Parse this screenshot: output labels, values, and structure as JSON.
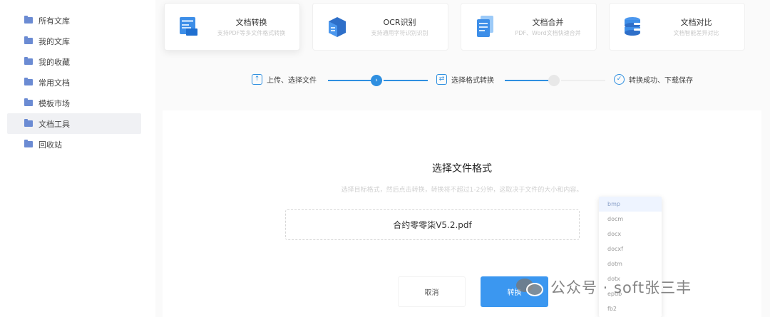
{
  "sidebar": {
    "items": [
      {
        "label": "所有文库",
        "active": false
      },
      {
        "label": "我的文库",
        "active": false
      },
      {
        "label": "我的收藏",
        "active": false
      },
      {
        "label": "常用文档",
        "active": false
      },
      {
        "label": "模板市场",
        "active": false
      },
      {
        "label": "文档工具",
        "active": true
      },
      {
        "label": "回收站",
        "active": false
      }
    ]
  },
  "tools": [
    {
      "title": "文档转换",
      "subtitle": "支持PDF等多文件格式转换",
      "icon": "document-convert-icon"
    },
    {
      "title": "OCR识别",
      "subtitle": "支持通用字符识别识别",
      "icon": "ocr-scan-icon"
    },
    {
      "title": "文档合并",
      "subtitle": "PDF、Word文档快速合并",
      "icon": "document-merge-icon"
    },
    {
      "title": "文档对比",
      "subtitle": "文档智能差异对比",
      "icon": "document-compare-icon"
    }
  ],
  "steps": [
    {
      "label": "上传、选择文件",
      "icon": "upload-icon"
    },
    {
      "label": "选择格式转换",
      "icon": "format-convert-icon"
    },
    {
      "label": "转换成功、下载保存",
      "icon": "check-circle-icon"
    }
  ],
  "main": {
    "title": "选择文件格式",
    "description": "选择目标格式，然后点击转换，转换将不超过1-2分钟，这取决于文件的大小和内容。",
    "file_name": "合约零零柒V5.2.pdf",
    "cancel_label": "取消",
    "convert_label": "转换"
  },
  "format_dropdown": {
    "options": [
      "bmp",
      "docm",
      "docx",
      "docxf",
      "dotm",
      "dotx",
      "epub",
      "fb2"
    ],
    "selected": "bmp"
  },
  "watermark": {
    "text": "公众号 · soft张三丰"
  },
  "colors": {
    "accent": "#3b97f0",
    "step_line": "#2f8fe0",
    "sidebar_folder": "#6b8bd3"
  }
}
